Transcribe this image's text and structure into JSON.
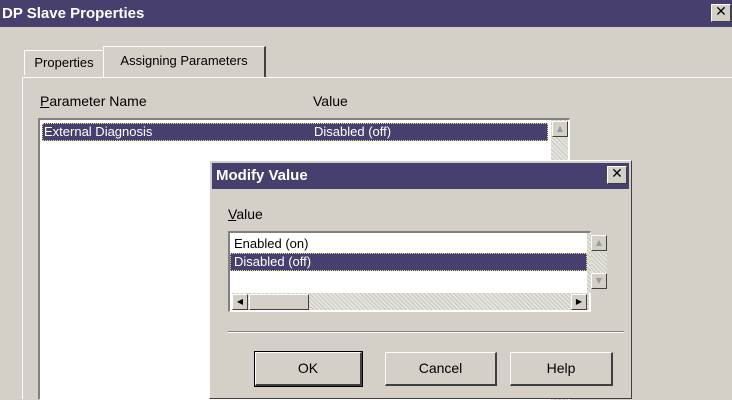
{
  "window": {
    "title": "DP Slave Properties",
    "close_glyph": "✕"
  },
  "tabs": [
    {
      "label": "Properties",
      "active": false
    },
    {
      "label": "Assigning Parameters",
      "active": true
    }
  ],
  "param_list": {
    "col_name_mnemonic": "P",
    "col_name_rest": "arameter Name",
    "col_value": "Value",
    "rows": [
      {
        "name": "External Diagnosis",
        "value": "Disabled (off)",
        "selected": true
      }
    ]
  },
  "modify_dialog": {
    "title": "Modify Value",
    "close_glyph": "✕",
    "value_label_mnemonic": "V",
    "value_label_rest": "alue",
    "options": [
      {
        "label": "Enabled (on)",
        "selected": false
      },
      {
        "label": "Disabled (off)",
        "selected": true
      }
    ],
    "buttons": {
      "ok": "OK",
      "cancel": "Cancel",
      "help": "Help"
    }
  },
  "icons": {
    "scroll_up": "▲",
    "scroll_down": "▼",
    "scroll_left": "◀",
    "scroll_right": "▶"
  },
  "colors": {
    "titlebar": "#473f6e",
    "face": "#d4d0c8",
    "selection": "#473f6e"
  }
}
